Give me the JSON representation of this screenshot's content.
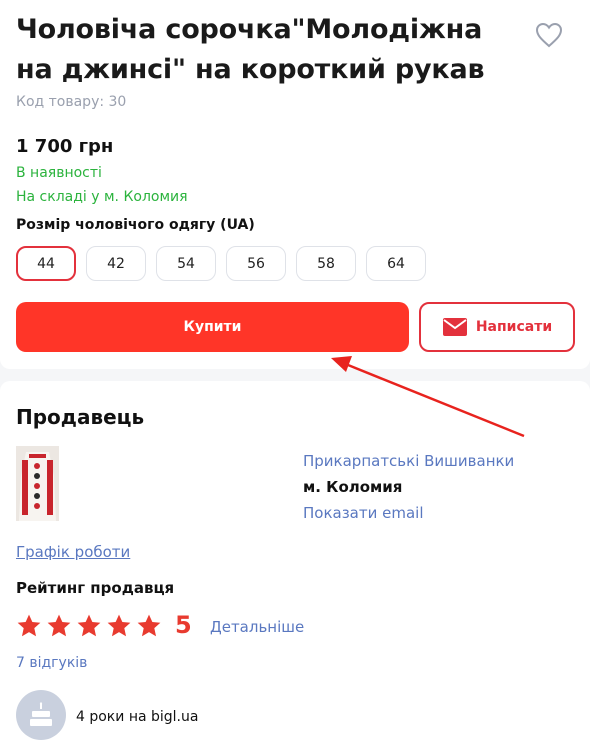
{
  "product": {
    "title": "Чоловіча сорочка\"Молодіжна на джинсі\" на короткий рукав",
    "code": "Код товару: 30",
    "price": "1 700 грн",
    "availability": "В наявності",
    "warehouse": "На складі у м. Коломия",
    "size_label": "Розмір чоловічого одягу (UA)",
    "sizes": [
      "44",
      "42",
      "54",
      "56",
      "58",
      "64"
    ],
    "selected_size": "44",
    "buy_label": "Купити",
    "write_label": "Написати"
  },
  "seller": {
    "heading": "Продавець",
    "shop_name": "Прикарпатські Вишиванки",
    "city": "м. Коломия",
    "show_email": "Показати email",
    "schedule": "Графік роботи",
    "rating_label": "Рейтинг продавця",
    "rating_value": "5",
    "stars": 5,
    "details": "Детальніше",
    "reviews": "7 відгуків",
    "years": "4 роки на bigl.ua"
  },
  "colors": {
    "accent": "#ff3528",
    "border_accent": "#e3313c",
    "link": "#5a78c0",
    "in_stock": "#2bb33d",
    "star": "#e83a2f"
  },
  "icons": {
    "heart": "heart-icon",
    "mail": "mail-icon",
    "star": "star-icon",
    "cake": "cake-icon",
    "annotation_arrow": "arrow-annotation"
  }
}
